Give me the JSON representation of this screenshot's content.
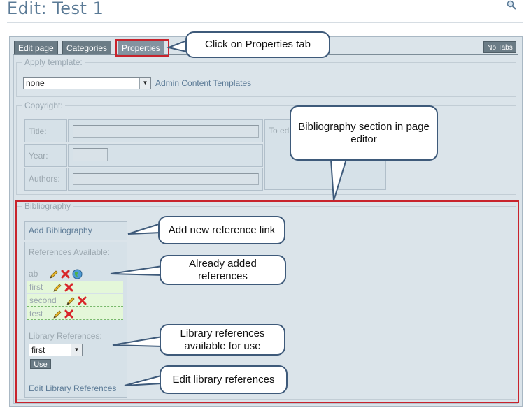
{
  "page": {
    "title": "Edit: Test 1"
  },
  "tabs": [
    {
      "label": "Edit page"
    },
    {
      "label": "Categories"
    },
    {
      "label": "Properties"
    }
  ],
  "no_tabs_label": "No Tabs",
  "apply_template": {
    "legend": "Apply template:",
    "selected": "none",
    "link": "Admin Content Templates"
  },
  "copyright": {
    "legend": "Copyright:",
    "title_label": "Title:",
    "year_label": "Year:",
    "authors_label": "Authors:",
    "partial_text": "To ed"
  },
  "bibliography": {
    "legend": "Bibliography",
    "add_link": "Add Bibliography",
    "references_label": "References Available:",
    "references": [
      {
        "name": "ab"
      },
      {
        "name": "first"
      },
      {
        "name": "second"
      },
      {
        "name": "test"
      }
    ],
    "library_label": "Library References:",
    "library_selected": "first",
    "use_label": "Use",
    "edit_library_link": "Edit Library References"
  },
  "callouts": {
    "properties_tab": "Click on Properties tab",
    "bibliography_section": "Bibliography section in page editor",
    "add_reference": "Add new reference link",
    "added_references": "Already added references",
    "library_available": "Library references available for use",
    "edit_library": "Edit library references"
  },
  "colors": {
    "highlight": "#c8232c",
    "callout_border": "#3e5a7a",
    "tab_bg": "#6b7c86",
    "editor_bg": "#dbe4ea",
    "reference_row_bg": "#e4f7d9"
  }
}
